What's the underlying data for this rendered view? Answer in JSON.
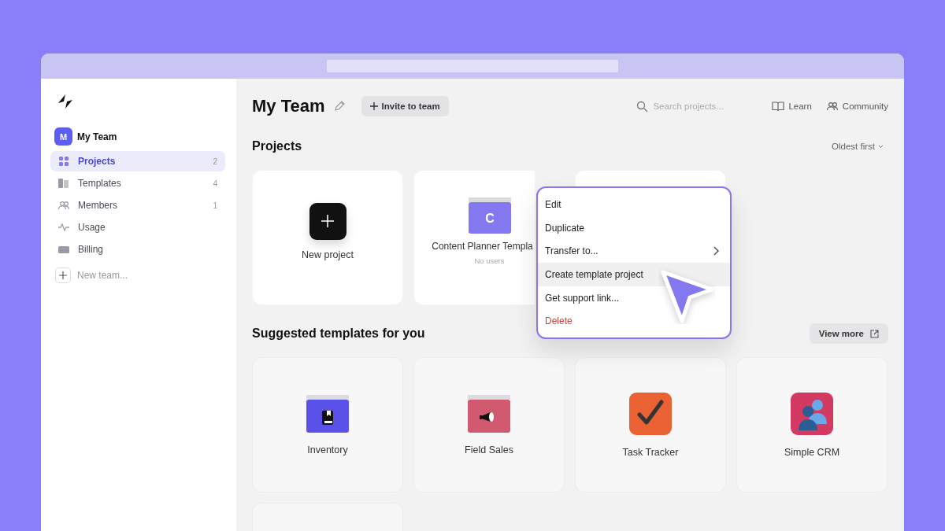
{
  "sidebar": {
    "team": {
      "initial": "M",
      "name": "My Team"
    },
    "items": [
      {
        "label": "Projects",
        "count": "2",
        "selected": true
      },
      {
        "label": "Templates",
        "count": "4",
        "selected": false
      },
      {
        "label": "Members",
        "count": "1",
        "selected": false
      },
      {
        "label": "Usage",
        "selected": false
      },
      {
        "label": "Billing",
        "selected": false
      }
    ],
    "new_team": "New team..."
  },
  "header": {
    "title": "My Team",
    "invite_button": "Invite to team",
    "search": {
      "placeholder": "Search projects..."
    },
    "links": [
      {
        "label": "Learn"
      },
      {
        "label": "Community"
      }
    ]
  },
  "projects": {
    "title": "Projects",
    "sort": "Oldest first",
    "cards": [
      {
        "kind": "new",
        "label": "New project"
      },
      {
        "kind": "project",
        "initial": "C",
        "color": "#8378f0",
        "label": "Content Planner Templa",
        "subtitle": "No users"
      },
      {
        "kind": "blank"
      }
    ]
  },
  "context_menu": {
    "items": [
      {
        "label": "Edit",
        "highlighted": false,
        "submenu": false,
        "danger": false
      },
      {
        "label": "Duplicate",
        "highlighted": false,
        "submenu": false,
        "danger": false
      },
      {
        "label": "Transfer to...",
        "highlighted": false,
        "submenu": true,
        "danger": false
      },
      {
        "label": "Create template project",
        "highlighted": true,
        "submenu": false,
        "danger": false
      },
      {
        "label": "Get support link...",
        "highlighted": false,
        "submenu": false,
        "danger": false
      },
      {
        "label": "Delete",
        "highlighted": false,
        "submenu": false,
        "danger": true
      }
    ]
  },
  "suggested": {
    "title": "Suggested templates for you",
    "view_more": "View more",
    "cards": [
      {
        "kind": "book",
        "color": "#5a52e8",
        "label": "Inventory"
      },
      {
        "kind": "megaphone",
        "color": "#d25a70",
        "label": "Field Sales"
      },
      {
        "kind": "check",
        "color": "#ea6234",
        "label": "Task Tracker"
      },
      {
        "kind": "people",
        "color": "#d23a62",
        "label": "Simple CRM"
      },
      {
        "kind": "blank"
      }
    ]
  }
}
